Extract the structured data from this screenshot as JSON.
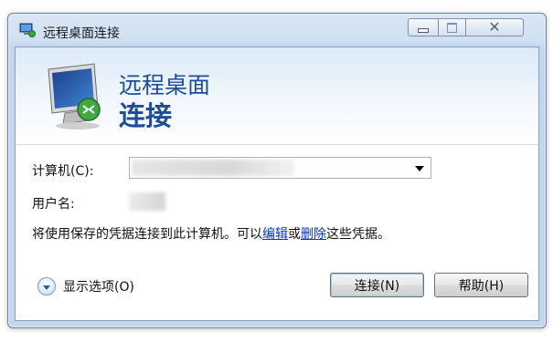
{
  "window": {
    "title": "远程桌面连接",
    "icon": "remote-desktop-icon",
    "controls": {
      "minimize": "minimize-icon",
      "maximize": "maximize-icon",
      "close": "close-icon"
    }
  },
  "banner": {
    "line1": "远程桌面",
    "line2": "连接",
    "icon": "monitor-connection-icon"
  },
  "form": {
    "computer_label": "计算机(C):",
    "computer_value": "",
    "user_label": "用户名:",
    "user_value": "",
    "info_text_before": "将使用保存的凭据连接到此计算机。可以",
    "edit_link": "编辑",
    "or_text": "或",
    "delete_link": "删除",
    "info_text_after": "这些凭据。"
  },
  "footer": {
    "options_label": "显示选项(O)",
    "connect_button": "连接(N)",
    "help_button": "帮助(H)"
  },
  "colors": {
    "accent": "#1e4e9a",
    "link": "#0033cc"
  }
}
